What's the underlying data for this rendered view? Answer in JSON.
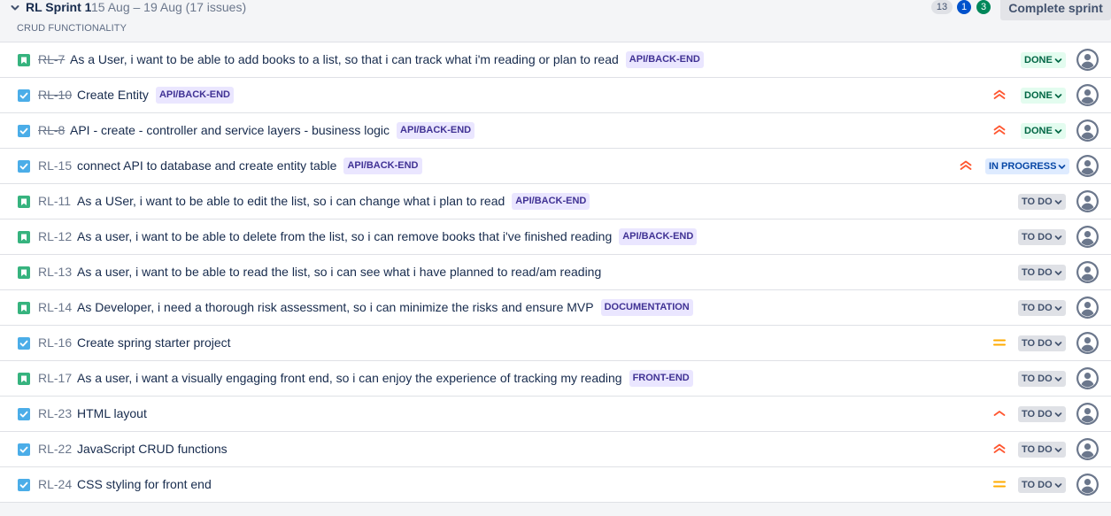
{
  "sprint": {
    "title": "RL Sprint 1",
    "dates": "15 Aug – 19 Aug  (17 issues)",
    "counts": {
      "todo": "13",
      "in_progress": "1",
      "done": "3"
    },
    "complete_label": "Complete sprint",
    "goal": "CRUD FUNCTIONALITY"
  },
  "colors": {
    "story": "#36b37e",
    "task": "#4bade8",
    "priority_high": "#ff5630",
    "priority_medium": "#ffab00"
  },
  "issues": [
    {
      "type": "story",
      "key": "RL-7",
      "done": true,
      "summary": "As a User, i want to be able to add books to a list, so that i can track what i'm reading or plan to read",
      "epic": "API/BACK-END",
      "priority": "",
      "status": "DONE",
      "status_kind": "done"
    },
    {
      "type": "task",
      "key": "RL-10",
      "done": true,
      "summary": "Create Entity",
      "epic": "API/BACK-END",
      "priority": "highest",
      "status": "DONE",
      "status_kind": "done"
    },
    {
      "type": "task",
      "key": "RL-8",
      "done": true,
      "summary": "API - create - controller and service layers - business logic",
      "epic": "API/BACK-END",
      "priority": "highest",
      "status": "DONE",
      "status_kind": "done"
    },
    {
      "type": "task",
      "key": "RL-15",
      "done": false,
      "summary": "connect API to database and create entity table",
      "epic": "API/BACK-END",
      "priority": "highest",
      "status": "IN PROGRESS",
      "status_kind": "prog"
    },
    {
      "type": "story",
      "key": "RL-11",
      "done": false,
      "summary": "As a USer, i want to be able to edit the list, so i can change what i plan to read",
      "epic": "API/BACK-END",
      "priority": "",
      "status": "TO DO",
      "status_kind": "todo"
    },
    {
      "type": "story",
      "key": "RL-12",
      "done": false,
      "summary": "As a user, i want to be able to delete from the list, so i can remove books that i've finished reading",
      "epic": "API/BACK-END",
      "priority": "",
      "status": "TO DO",
      "status_kind": "todo"
    },
    {
      "type": "story",
      "key": "RL-13",
      "done": false,
      "summary": "As a user, i want to be able to read the list, so i can see what i have planned to read/am reading",
      "epic": "",
      "priority": "",
      "status": "TO DO",
      "status_kind": "todo"
    },
    {
      "type": "story",
      "key": "RL-14",
      "done": false,
      "summary": "As Developer, i need a thorough risk assessment, so i can minimize the risks and ensure MVP",
      "epic": "DOCUMENTATION",
      "priority": "",
      "status": "TO DO",
      "status_kind": "todo"
    },
    {
      "type": "task",
      "key": "RL-16",
      "done": false,
      "summary": "Create spring starter project",
      "epic": "",
      "priority": "medium",
      "status": "TO DO",
      "status_kind": "todo"
    },
    {
      "type": "story",
      "key": "RL-17",
      "done": false,
      "summary": "As a user, i want a visually engaging front end, so i can enjoy the experience of tracking my reading",
      "epic": "FRONT-END",
      "priority": "",
      "status": "TO DO",
      "status_kind": "todo"
    },
    {
      "type": "task",
      "key": "RL-23",
      "done": false,
      "summary": "HTML layout",
      "epic": "",
      "priority": "high",
      "status": "TO DO",
      "status_kind": "todo"
    },
    {
      "type": "task",
      "key": "RL-22",
      "done": false,
      "summary": "JavaScript CRUD functions",
      "epic": "",
      "priority": "highest",
      "status": "TO DO",
      "status_kind": "todo"
    },
    {
      "type": "task",
      "key": "RL-24",
      "done": false,
      "summary": "CSS styling for front end",
      "epic": "",
      "priority": "medium",
      "status": "TO DO",
      "status_kind": "todo"
    }
  ]
}
